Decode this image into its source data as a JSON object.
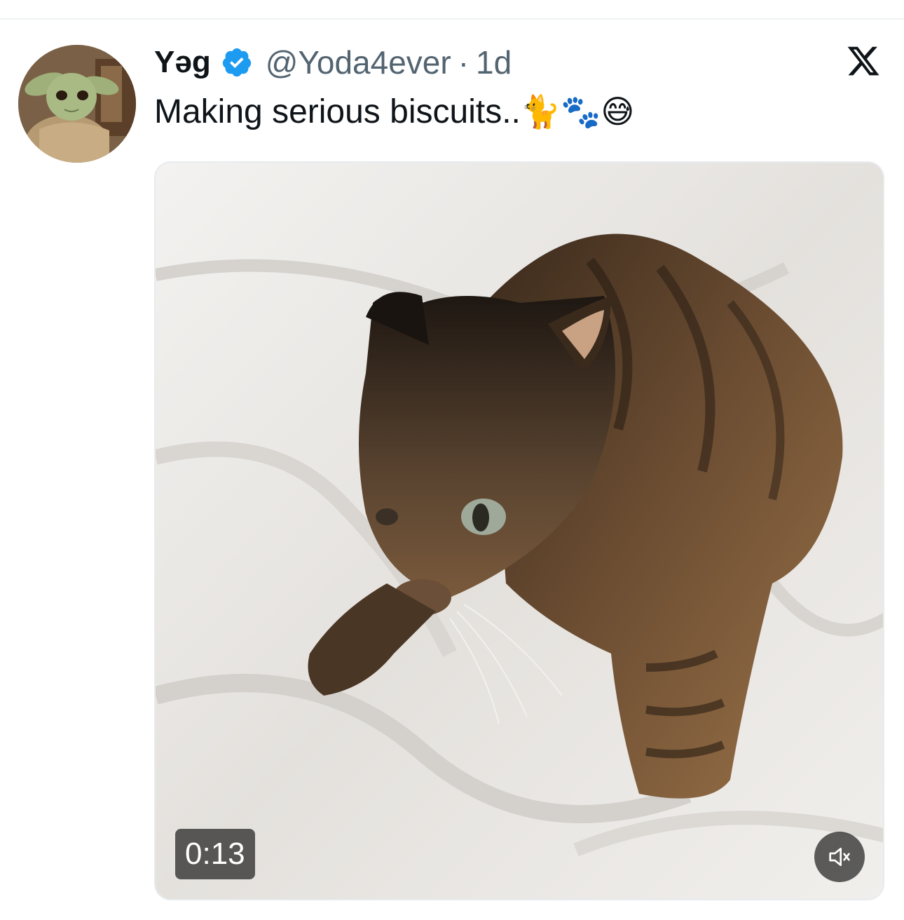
{
  "tweet": {
    "display_name": "Yəg",
    "handle": "@Yoda4ever",
    "separator": "·",
    "timestamp": "1d",
    "text": "Making serious biscuits..",
    "emojis": "🐈🐾😅",
    "verified": true
  },
  "media": {
    "type": "video",
    "duration": "0:13",
    "muted": true
  },
  "icons": {
    "verified": "verified-badge-icon",
    "brand": "x-logo-icon",
    "mute": "speaker-muted-icon"
  },
  "colors": {
    "verified_blue": "#1d9bf0",
    "secondary_text": "#536471",
    "primary_text": "#0f1419"
  }
}
